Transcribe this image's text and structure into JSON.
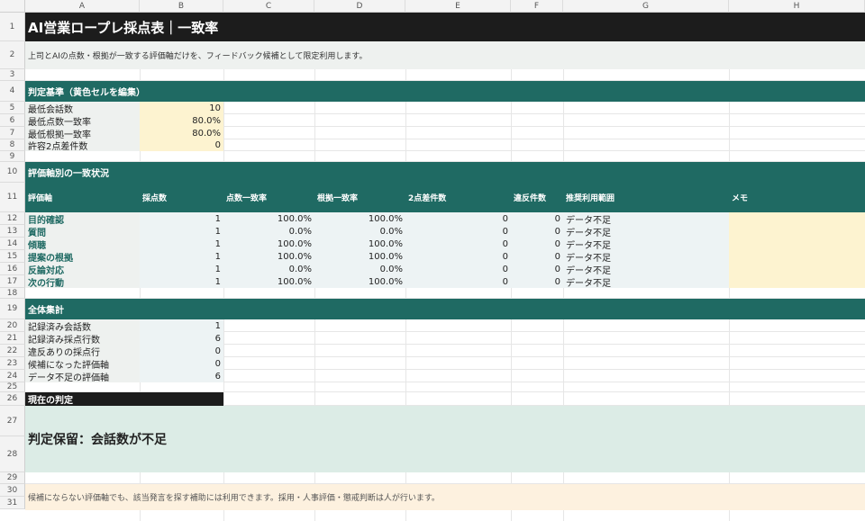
{
  "columns": [
    "A",
    "B",
    "C",
    "D",
    "E",
    "F",
    "G",
    "H"
  ],
  "rows": [
    "1",
    "2",
    "3",
    "4",
    "5",
    "6",
    "7",
    "8",
    "9",
    "10",
    "11",
    "12",
    "13",
    "14",
    "15",
    "16",
    "17",
    "18",
    "19",
    "20",
    "21",
    "22",
    "23",
    "24",
    "25",
    "26",
    "27",
    "28",
    "29",
    "30",
    "31"
  ],
  "title": "AI営業ロープレ採点表｜一致率",
  "subtitle": "上司とAIの点数・根拠が一致する評価軸だけを、フィードバック候補として限定利用します。",
  "criteria": {
    "header": "判定基準（黄色セルを編集）",
    "items": [
      {
        "label": "最低会話数",
        "value": "10"
      },
      {
        "label": "最低点数一致率",
        "value": "80.0%"
      },
      {
        "label": "最低根拠一致率",
        "value": "80.0%"
      },
      {
        "label": "許容2点差件数",
        "value": "0"
      }
    ]
  },
  "axes": {
    "header": "評価軸別の一致状況",
    "columns": [
      "評価軸",
      "採点数",
      "点数一致率",
      "根拠一致率",
      "2点差件数",
      "違反件数",
      "推奨利用範囲",
      "メモ"
    ],
    "rows": [
      {
        "axis": "目的確認",
        "count": "1",
        "score_match": "100.0%",
        "basis_match": "100.0%",
        "diff2": "0",
        "violations": "0",
        "scope": "データ不足"
      },
      {
        "axis": "質問",
        "count": "1",
        "score_match": "0.0%",
        "basis_match": "0.0%",
        "diff2": "0",
        "violations": "0",
        "scope": "データ不足"
      },
      {
        "axis": "傾聴",
        "count": "1",
        "score_match": "100.0%",
        "basis_match": "100.0%",
        "diff2": "0",
        "violations": "0",
        "scope": "データ不足"
      },
      {
        "axis": "提案の根拠",
        "count": "1",
        "score_match": "100.0%",
        "basis_match": "100.0%",
        "diff2": "0",
        "violations": "0",
        "scope": "データ不足"
      },
      {
        "axis": "反論対応",
        "count": "1",
        "score_match": "0.0%",
        "basis_match": "0.0%",
        "diff2": "0",
        "violations": "0",
        "scope": "データ不足"
      },
      {
        "axis": "次の行動",
        "count": "1",
        "score_match": "100.0%",
        "basis_match": "100.0%",
        "diff2": "0",
        "violations": "0",
        "scope": "データ不足"
      }
    ]
  },
  "summary": {
    "header": "全体集計",
    "items": [
      {
        "label": "記録済み会話数",
        "value": "1"
      },
      {
        "label": "記録済み採点行数",
        "value": "6"
      },
      {
        "label": "違反ありの採点行",
        "value": "0"
      },
      {
        "label": "候補になった評価軸",
        "value": "0"
      },
      {
        "label": "データ不足の評価軸",
        "value": "6"
      }
    ]
  },
  "verdict": {
    "header": "現在の判定",
    "text": "判定保留：会話数が不足"
  },
  "footer": "候補にならない評価軸でも、該当発言を探す補助には利用できます。採用・人事評価・懲戒判断は人が行います。",
  "colors": {
    "header_teal": "#1f6a63",
    "dark_header": "#1c1c1c",
    "input_yellow": "#fdf3d0",
    "label_gray": "#eef1ef",
    "verdict_green": "#dcece6",
    "footer_cream": "#fdf1df",
    "axis_text": "#1f6a63"
  }
}
